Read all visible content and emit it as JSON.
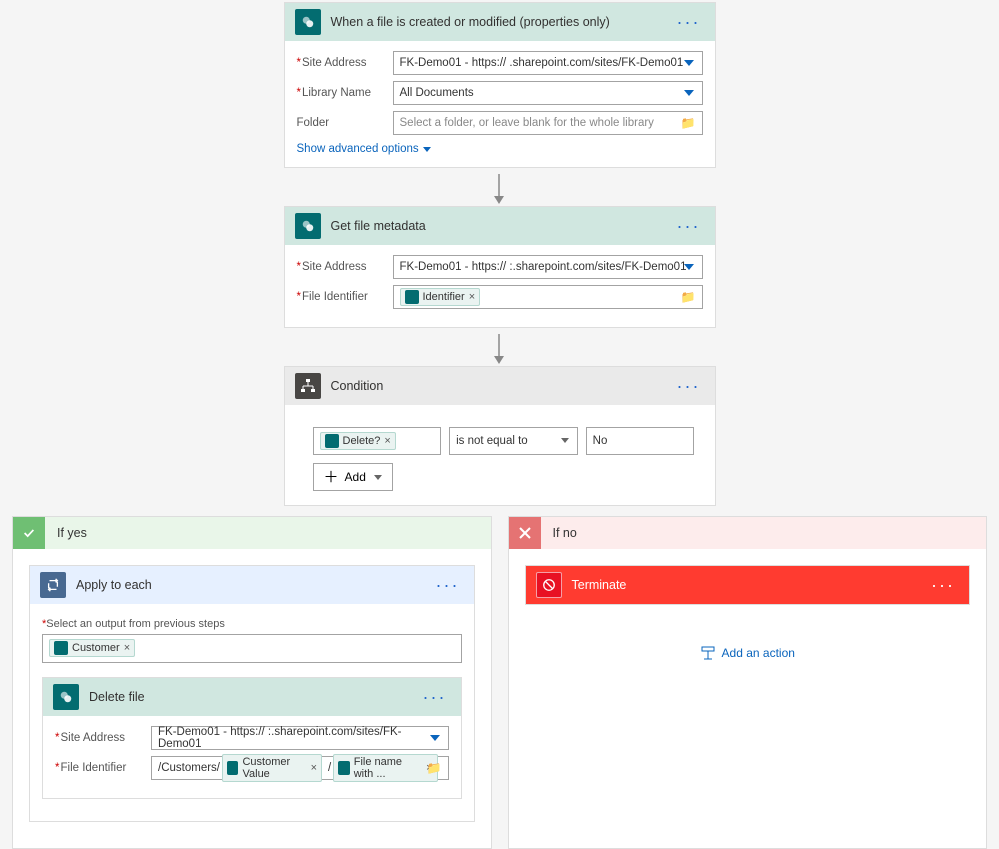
{
  "trigger": {
    "title": "When a file is created or modified (properties only)",
    "fields": {
      "siteLabel": "Site Address",
      "siteValue": "FK-Demo01 - https://           .sharepoint.com/sites/FK-Demo01",
      "libLabel": "Library Name",
      "libValue": "All Documents",
      "folderLabel": "Folder",
      "folderPlaceholder": "Select a folder, or leave blank for the whole library"
    },
    "advanced": "Show advanced options"
  },
  "getMeta": {
    "title": "Get file metadata",
    "siteLabel": "Site Address",
    "siteValue": "FK-Demo01 - https://           :.sharepoint.com/sites/FK-Demo01",
    "fileIdLabel": "File Identifier",
    "fileIdToken": "Identifier"
  },
  "condition": {
    "title": "Condition",
    "leftToken": "Delete?",
    "operator": "is not equal to",
    "right": "No",
    "addBtn": "Add"
  },
  "yes": {
    "label": "If yes",
    "applyEach": "Apply to each",
    "prevStepsLabel": "Select an output from previous steps",
    "customerToken": "Customer",
    "deleteFile": {
      "title": "Delete file",
      "siteLabel": "Site Address",
      "siteValue": "FK-Demo01 - https://           :.sharepoint.com/sites/FK-Demo01",
      "fileIdLabel": "File Identifier",
      "pathPrefix": "/Customers/",
      "token1": "Customer Value",
      "pathSep": "/",
      "token2": "File name with ..."
    }
  },
  "no": {
    "label": "If no",
    "terminate": "Terminate",
    "addAction": "Add an action"
  }
}
